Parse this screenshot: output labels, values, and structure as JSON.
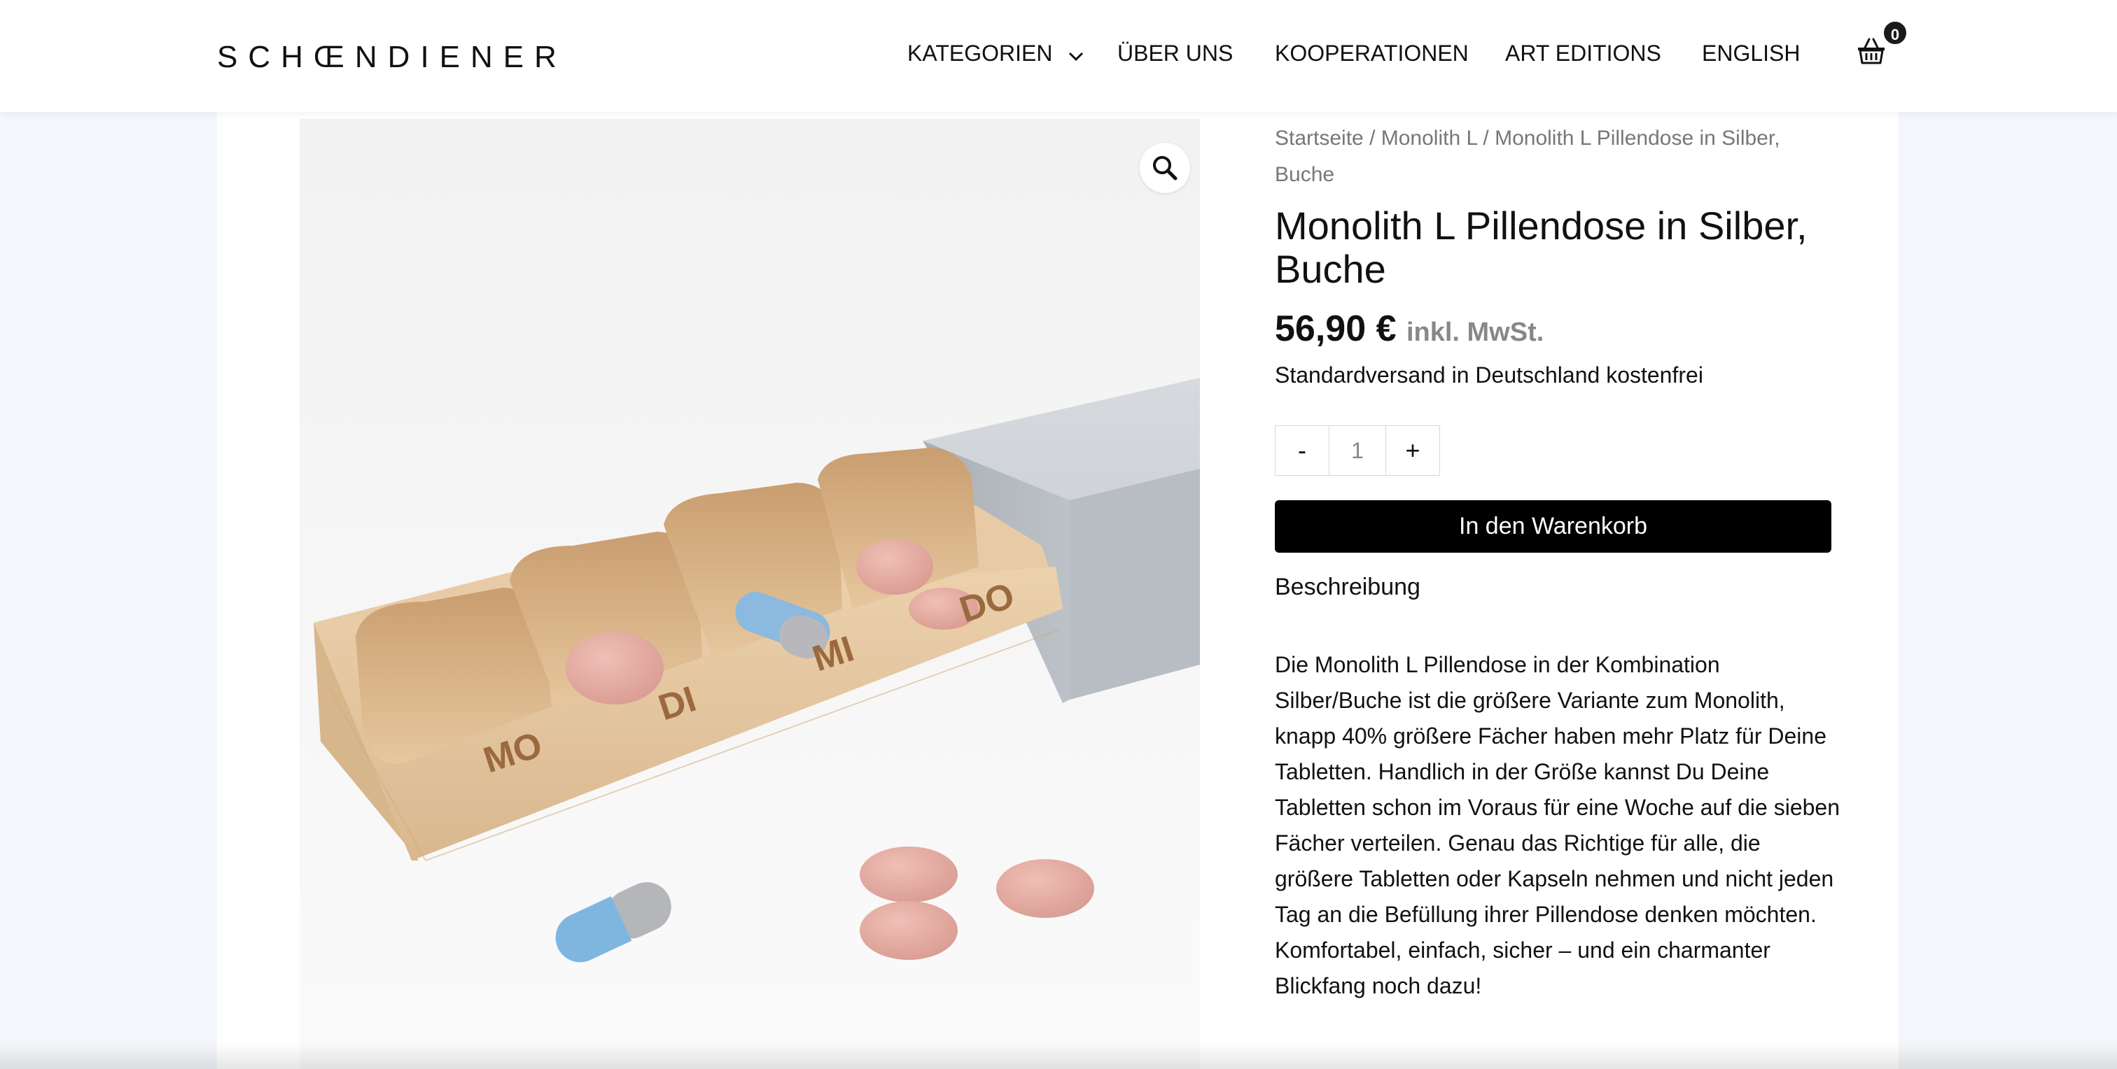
{
  "brand": {
    "logo_text": "SCHŒNDIENER"
  },
  "nav": {
    "items": [
      {
        "label": "KATEGORIEN",
        "has_dropdown": true
      },
      {
        "label": "ÜBER UNS"
      },
      {
        "label": "KOOPERATIONEN"
      },
      {
        "label": "ART EDITIONS"
      },
      {
        "label": "ENGLISH"
      }
    ],
    "cart_count": "0"
  },
  "breadcrumb": {
    "home": "Startseite",
    "sep1": " / ",
    "category": "Monolith L",
    "sep2": " / ",
    "current": "Monolith L Pillendose in Silber, Buche"
  },
  "product": {
    "title": "Monolith L Pillendose in Silber, Buche",
    "price": "56,90 €",
    "vat_note": "inkl. MwSt.",
    "shipping": "Standardversand in Deutschland kostenfrei",
    "quantity": "1",
    "qty_minus": "-",
    "qty_plus": "+",
    "add_to_cart": "In den Warenkorb",
    "description_label": "Beschreibung",
    "description": "Die Monolith L Pillendose in der Kombination Silber/Buche ist die größere Variante zum Monolith, knapp 40% größere Fächer haben mehr Platz für Deine Tabletten. Handlich in der Größe kannst Du Deine Tabletten schon im Voraus für eine Woche auf die sieben Fächer verteilen. Genau das Richtige für alle, die größere Tabletten oder Kapseln nehmen und nicht jeden Tag an die Befüllung ihrer Pillendose denken möchten. Komfortabel, einfach, sicher – und ein charmanter Blickfang noch dazu!",
    "image": {
      "day_labels": [
        "MO",
        "DI",
        "MI",
        "DO"
      ]
    }
  },
  "icons": {
    "zoom": "magnifier-icon",
    "cart": "basket-icon",
    "dropdown": "chevron-down-icon"
  },
  "colors": {
    "button_bg": "#000000",
    "price_muted": "#888888",
    "page_bg": "#f3f6fa",
    "wood": "#e3c49c",
    "silver": "#b8bec4",
    "pill_pink": "#e4aaa0",
    "capsule_blue": "#7fb6e0"
  }
}
